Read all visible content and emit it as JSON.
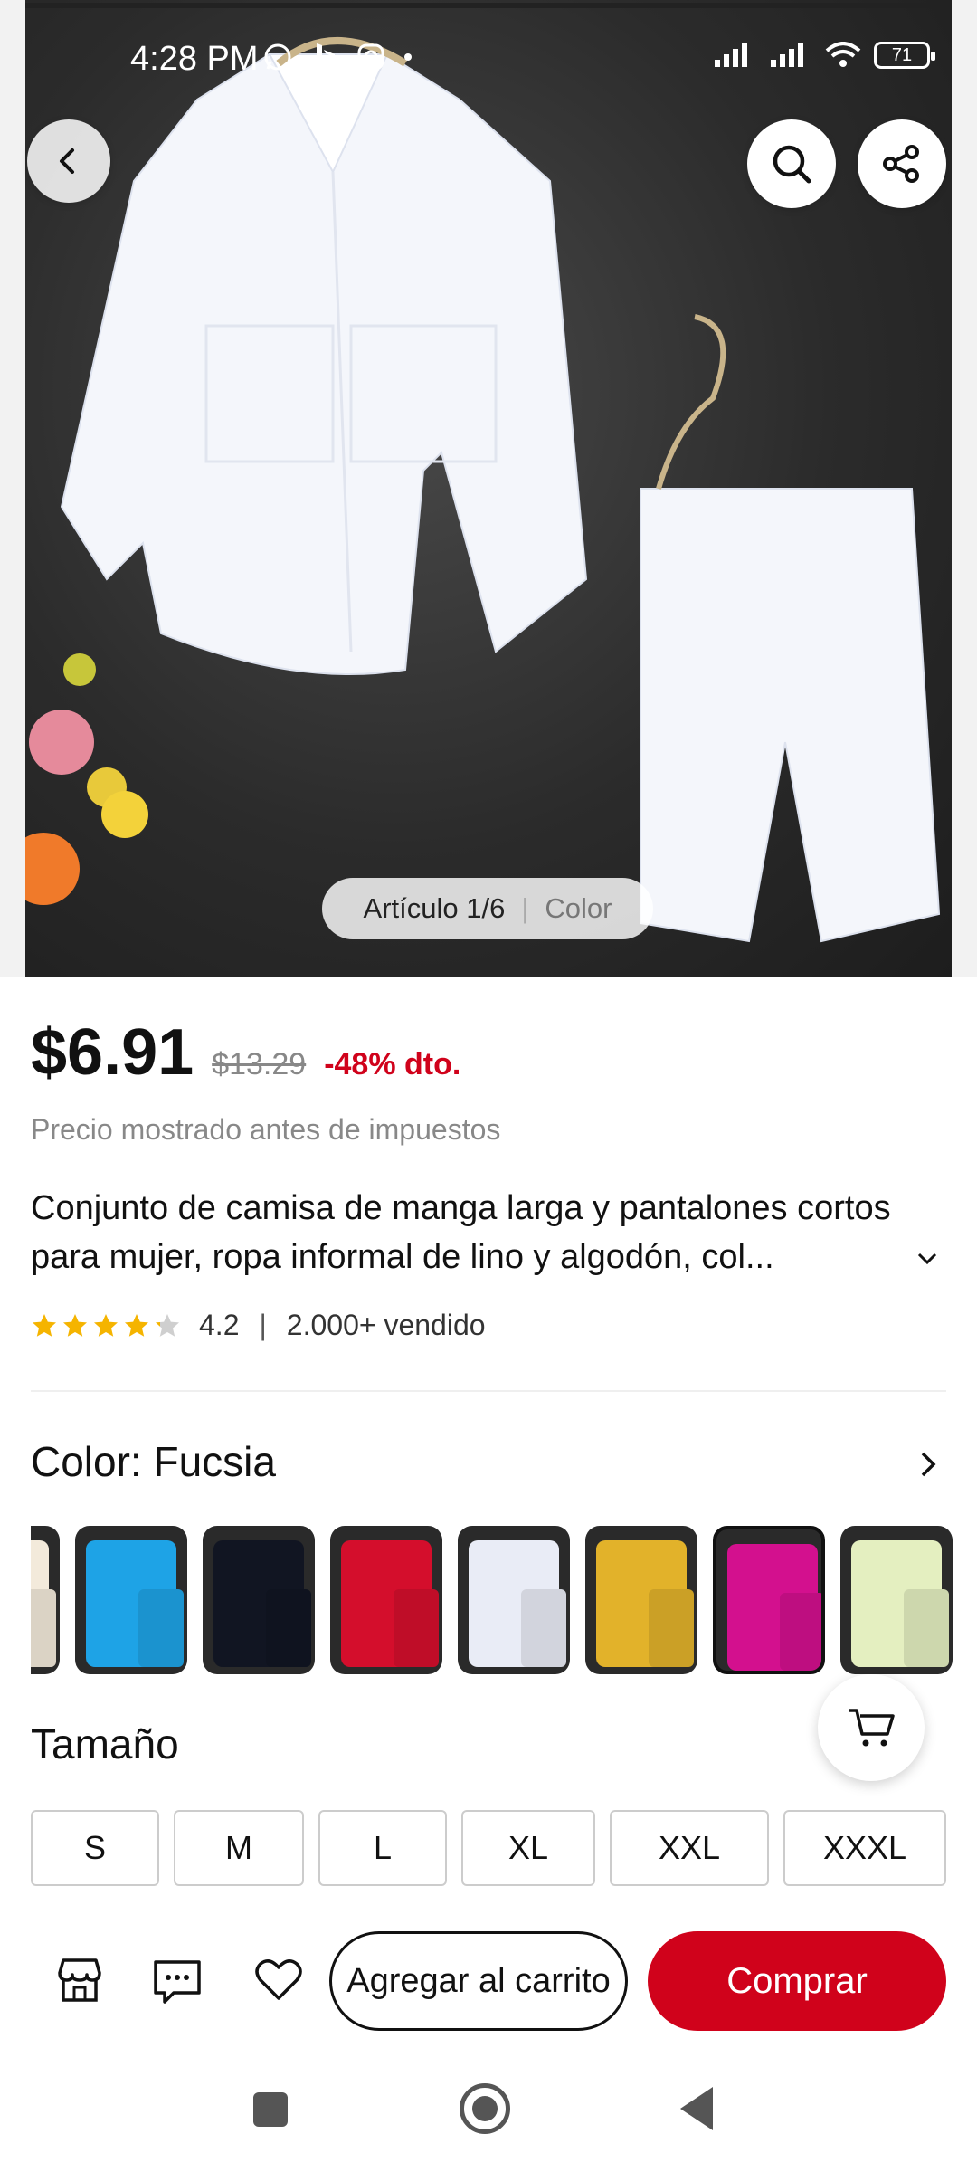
{
  "status_bar": {
    "time": "4:28 PM",
    "battery": "71"
  },
  "gallery": {
    "counter_label": "Artículo 1/6",
    "color_tab": "Color"
  },
  "product": {
    "price": "$6.91",
    "original_price": "$13.29",
    "discount": "-48% dto.",
    "tax_note": "Precio mostrado antes de impuestos",
    "title": "Conjunto de camisa de manga larga y pantalones cortos para mujer, ropa informal de lino y algodón, col...",
    "rating": "4.2",
    "rating_stars": 4.2,
    "sold": "2.000+ vendido"
  },
  "color": {
    "label": "Color: Fucsia",
    "swatches": [
      {
        "name": "beige",
        "hex": "#f3eadb"
      },
      {
        "name": "sky-blue",
        "hex": "#1ea3e6"
      },
      {
        "name": "black",
        "hex": "#111522"
      },
      {
        "name": "red",
        "hex": "#d40e2c"
      },
      {
        "name": "white",
        "hex": "#e9ecf6"
      },
      {
        "name": "yellow",
        "hex": "#e2b22a"
      },
      {
        "name": "fuchsia",
        "hex": "#d3108e",
        "selected": true
      },
      {
        "name": "light-green",
        "hex": "#e4efc0"
      }
    ]
  },
  "size": {
    "title": "Tamaño",
    "options": [
      "S",
      "M",
      "L",
      "XL",
      "XXL",
      "XXXL"
    ]
  },
  "actions": {
    "add_to_cart": "Agregar al carrito",
    "buy": "Comprar"
  },
  "colors": {
    "accent": "#d0021b"
  }
}
